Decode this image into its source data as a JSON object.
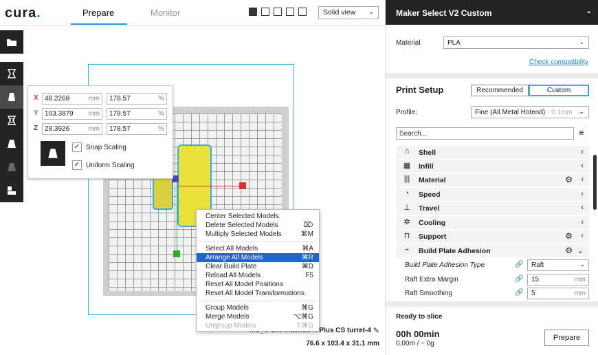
{
  "app": {
    "logo_text": "cura",
    "logo_dot": ".",
    "tabs": [
      {
        "label": "Prepare",
        "active": true
      },
      {
        "label": "Monitor",
        "active": false
      }
    ],
    "view_select": "Solid view",
    "view_icons": [
      "3d-view-icon",
      "front-view-icon",
      "top-view-icon",
      "left-view-icon",
      "right-view-icon"
    ]
  },
  "left_tools": [
    "open-file-icon",
    "move-tool-icon",
    "scale-tool-icon",
    "rotate-tool-icon",
    "mirror-tool-icon",
    "per-model-settings-icon",
    "support-blocker-icon"
  ],
  "scale_panel": {
    "x": {
      "label": "X",
      "mm": "48.2268",
      "mm_unit": "mm",
      "pct": "178.57",
      "pct_unit": "%"
    },
    "y": {
      "label": "Y",
      "mm": "103.3879",
      "mm_unit": "mm",
      "pct": "178.57",
      "pct_unit": "%"
    },
    "z": {
      "label": "Z",
      "mm": "28.3926",
      "mm_unit": "mm",
      "pct": "178.57",
      "pct_unit": "%"
    },
    "snap_scaling": {
      "label": "Snap Scaling",
      "checked": true
    },
    "uniform_scaling": {
      "label": "Uniform Scaling",
      "checked": true
    },
    "axis_colors": {
      "x": "#d33",
      "y": "#3a3",
      "z": "#44c"
    }
  },
  "context_menu": {
    "items": [
      {
        "label": "Center Selected Models",
        "shortcut": ""
      },
      {
        "label": "Delete Selected Models",
        "shortcut": "⌦"
      },
      {
        "label": "Multiply Selected Models",
        "shortcut": "⌘M"
      },
      {
        "label": "Select All Models",
        "shortcut": "⌘A"
      },
      {
        "label": "Arrange All Models",
        "shortcut": "⌘R",
        "highlighted": true
      },
      {
        "label": "Clear Build Plate",
        "shortcut": "⌘D"
      },
      {
        "label": "Reload All Models",
        "shortcut": "F5"
      },
      {
        "label": "Reset All Model Positions",
        "shortcut": ""
      },
      {
        "label": "Reset All Model Transformations",
        "shortcut": ""
      },
      {
        "label": "Group Models",
        "shortcut": "⌘G"
      },
      {
        "label": "Merge Models",
        "shortcut": "⌥⌘G"
      },
      {
        "label": "Ungroup Models",
        "shortcut": "⇧⌘G",
        "disabled": true
      }
    ]
  },
  "model_info": {
    "name": "MS_C-100 Malmud R Plus CS turret-4",
    "dims": "76.6 x 103.4 x 31.1 mm"
  },
  "right_panel": {
    "printer": "Maker Select V2 Custom",
    "material_label": "Material",
    "material_value": "PLA",
    "check_compat": "Check compatibility",
    "print_setup": "Print Setup",
    "mode_recommended": "Recommended",
    "mode_custom": "Custom",
    "profile_label": "Profile:",
    "profile_value": "Fine (All Metal Hotend)",
    "profile_layer": "- 0.1mm",
    "search_placeholder": "Search...",
    "categories": [
      {
        "label": "Shell",
        "icon": "shell-icon",
        "glyph": "⌂",
        "gear": false,
        "expanded": false
      },
      {
        "label": "Infill",
        "icon": "infill-icon",
        "glyph": "▦",
        "gear": false,
        "expanded": false
      },
      {
        "label": "Material",
        "icon": "material-icon",
        "glyph": "|||",
        "gear": true,
        "expanded": false
      },
      {
        "label": "Speed",
        "icon": "speed-icon",
        "glyph": "◔",
        "gear": false,
        "expanded": false
      },
      {
        "label": "Travel",
        "icon": "travel-icon",
        "glyph": "⊥",
        "gear": false,
        "expanded": false
      },
      {
        "label": "Cooling",
        "icon": "cooling-icon",
        "glyph": "✲",
        "gear": false,
        "expanded": false
      },
      {
        "label": "Support",
        "icon": "support-icon",
        "glyph": "⊓",
        "gear": true,
        "expanded": false
      },
      {
        "label": "Build Plate Adhesion",
        "icon": "adhesion-icon",
        "glyph": "÷",
        "gear": true,
        "expanded": true
      }
    ],
    "settings": [
      {
        "label": "Build Plate Adhesion Type",
        "value": "Raft",
        "unit": "",
        "dropdown": true
      },
      {
        "label": "Raft Extra Margin",
        "value": "15",
        "unit": "mm",
        "dropdown": false
      },
      {
        "label": "Raft Smoothing",
        "value": "5",
        "unit": "mm",
        "dropdown": false
      }
    ],
    "ready_label": "Ready to slice",
    "time": "00h 00min",
    "material_estimate": "0.00m / ~ 0g",
    "prepare_button": "Prepare"
  }
}
